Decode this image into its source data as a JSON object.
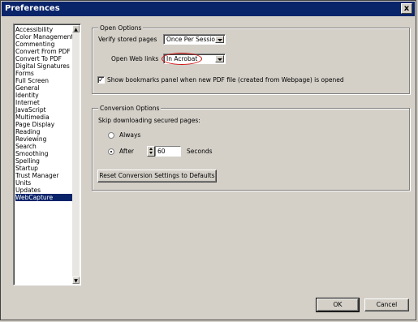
{
  "window": {
    "title": "Preferences",
    "close_glyph": "x"
  },
  "categories": {
    "items": [
      "Accessibility",
      "Color Management",
      "Commenting",
      "Convert From PDF",
      "Convert To PDF",
      "Digital Signatures",
      "Forms",
      "Full Screen",
      "General",
      "Identity",
      "Internet",
      "JavaScript",
      "Multimedia",
      "Page Display",
      "Reading",
      "Reviewing",
      "Search",
      "Smoothing",
      "Spelling",
      "Startup",
      "Trust Manager",
      "Units",
      "Updates",
      "WebCapture"
    ],
    "selected": "WebCapture",
    "scroll_up_glyph": "▲",
    "scroll_down_glyph": "▼"
  },
  "open_options": {
    "group_title": "Open Options",
    "verify_label": "Verify stored pages",
    "verify_value": "Once Per Session",
    "weblinks_label": "Open Web links",
    "weblinks_value": "In Acrobat",
    "bookmarks_checked": true,
    "bookmarks_label": "Show bookmarks panel when new PDF file (created from Webpage) is opened",
    "check_glyph": "✓"
  },
  "conversion_options": {
    "group_title": "Conversion Options",
    "skip_label": "Skip downloading secured pages:",
    "always_label": "Always",
    "after_label": "After",
    "after_selected": true,
    "after_value": "60",
    "seconds_label": "Seconds",
    "reset_button": "Reset Conversion Settings to Defaults"
  },
  "footer": {
    "ok": "OK",
    "cancel": "Cancel"
  },
  "colors": {
    "title_bar": "#0a246a",
    "dialog_bg": "#d4d0c8",
    "highlight_ellipse": "#d01010"
  }
}
